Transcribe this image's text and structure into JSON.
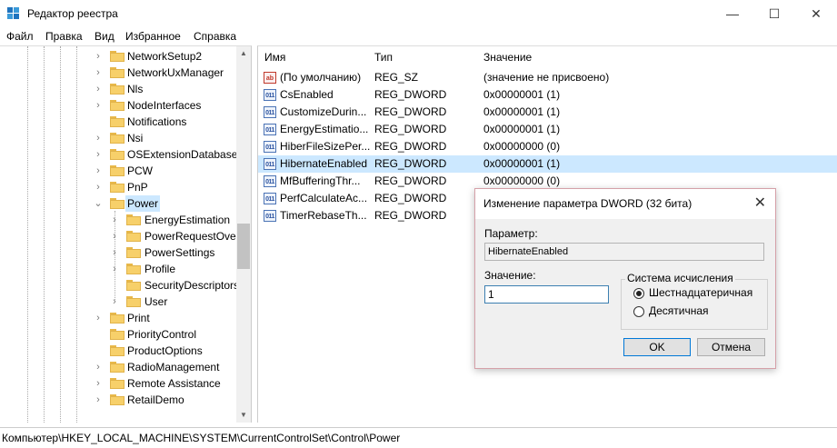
{
  "window": {
    "title": "Редактор реестра",
    "minimize": "—",
    "maximize": "☐",
    "close": "✕"
  },
  "menu": [
    "Файл",
    "Правка",
    "Вид",
    "Избранное",
    "Справка"
  ],
  "tree": {
    "items": [
      {
        "label": "NetworkSetup2",
        "expander": "›"
      },
      {
        "label": "NetworkUxManager",
        "expander": "›"
      },
      {
        "label": "Nls",
        "expander": "›"
      },
      {
        "label": "NodeInterfaces",
        "expander": "›"
      },
      {
        "label": "Notifications",
        "expander": ""
      },
      {
        "label": "Nsi",
        "expander": "›"
      },
      {
        "label": "OSExtensionDatabase",
        "expander": "›"
      },
      {
        "label": "PCW",
        "expander": "›"
      },
      {
        "label": "PnP",
        "expander": "›"
      },
      {
        "label": "Power",
        "expander": "⌄"
      },
      {
        "label": "EnergyEstimation",
        "expander": "›"
      },
      {
        "label": "PowerRequestOver",
        "expander": "›"
      },
      {
        "label": "PowerSettings",
        "expander": "›"
      },
      {
        "label": "Profile",
        "expander": "›"
      },
      {
        "label": "SecurityDescriptors",
        "expander": ""
      },
      {
        "label": "User",
        "expander": "›"
      },
      {
        "label": "Print",
        "expander": "›"
      },
      {
        "label": "PriorityControl",
        "expander": ""
      },
      {
        "label": "ProductOptions",
        "expander": ""
      },
      {
        "label": "RadioManagement",
        "expander": "›"
      },
      {
        "label": "Remote Assistance",
        "expander": "›"
      },
      {
        "label": "RetailDemo",
        "expander": "›"
      }
    ]
  },
  "values": {
    "headers": {
      "name": "Имя",
      "type": "Тип",
      "data": "Значение"
    },
    "rows": [
      {
        "icon": "ab",
        "name": "(По умолчанию)",
        "type": "REG_SZ",
        "data": "(значение не присвоено)"
      },
      {
        "icon": "011",
        "name": "CsEnabled",
        "type": "REG_DWORD",
        "data": "0x00000001 (1)"
      },
      {
        "icon": "011",
        "name": "CustomizeDurin...",
        "type": "REG_DWORD",
        "data": "0x00000001 (1)"
      },
      {
        "icon": "011",
        "name": "EnergyEstimatio...",
        "type": "REG_DWORD",
        "data": "0x00000001 (1)"
      },
      {
        "icon": "011",
        "name": "HiberFileSizePer...",
        "type": "REG_DWORD",
        "data": "0x00000000 (0)"
      },
      {
        "icon": "011",
        "name": "HibernateEnabled",
        "type": "REG_DWORD",
        "data": "0x00000001 (1)"
      },
      {
        "icon": "011",
        "name": "MfBufferingThr...",
        "type": "REG_DWORD",
        "data": "0x00000000 (0)"
      },
      {
        "icon": "011",
        "name": "PerfCalculateAc...",
        "type": "REG_DWORD",
        "data": ""
      },
      {
        "icon": "011",
        "name": "TimerRebaseTh...",
        "type": "REG_DWORD",
        "data": ""
      }
    ]
  },
  "status": "Компьютер\\HKEY_LOCAL_MACHINE\\SYSTEM\\CurrentControlSet\\Control\\Power",
  "dialog": {
    "title": "Изменение параметра DWORD (32 бита)",
    "close": "✕",
    "param_label": "Параметр:",
    "param_value": "HibernateEnabled",
    "value_label": "Значение:",
    "value": "1",
    "base_group": "Система исчисления",
    "radio_hex": "Шестнадцатеричная",
    "radio_dec": "Десятичная",
    "ok": "OK",
    "cancel": "Отмена"
  }
}
